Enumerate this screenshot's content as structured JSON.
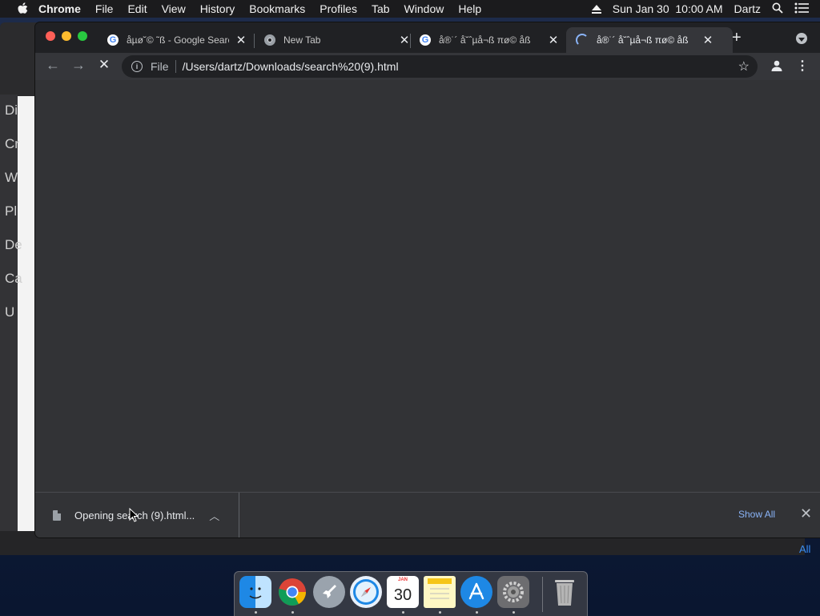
{
  "menubar": {
    "app": "Chrome",
    "items": [
      "File",
      "Edit",
      "View",
      "History",
      "Bookmarks",
      "Profiles",
      "Tab",
      "Window",
      "Help"
    ],
    "datetime": "Sun Jan 30  10:00 AM",
    "user": "Dartz"
  },
  "background_window": {
    "sidebar_items": [
      "Di",
      "Cr",
      "W",
      "Pl",
      "De",
      "Ca",
      "U"
    ],
    "bottom_link": "All"
  },
  "tabs": [
    {
      "title": "åµø˘© ˜ß - Google Search",
      "favicon": "google-icon"
    },
    {
      "title": "New Tab",
      "favicon": "chrome-icon"
    },
    {
      "title": "å®˙´ å˘ˆµå¬ß πø© åß",
      "favicon": "google-icon"
    },
    {
      "title": "å®˙´ å˘ˆµå¬ß πø© åß",
      "favicon": "loading-spinner",
      "active": true
    }
  ],
  "toolbar": {
    "scheme_label": "File",
    "url": "/Users/dartz/Downloads/search%20(9).html"
  },
  "download_bar": {
    "item_text": "Opening search (9).html...",
    "show_all": "Show All"
  },
  "dock": {
    "apps": [
      "finder",
      "chrome",
      "launchpad",
      "safari",
      "calendar",
      "notes",
      "app-store",
      "system-preferences",
      "trash"
    ],
    "calendar_month": "JAN",
    "calendar_day": "30"
  },
  "colors": {
    "chrome_frame": "#202124",
    "toolbar": "#35363a",
    "content": "#323336",
    "link": "#8ab4f8"
  }
}
